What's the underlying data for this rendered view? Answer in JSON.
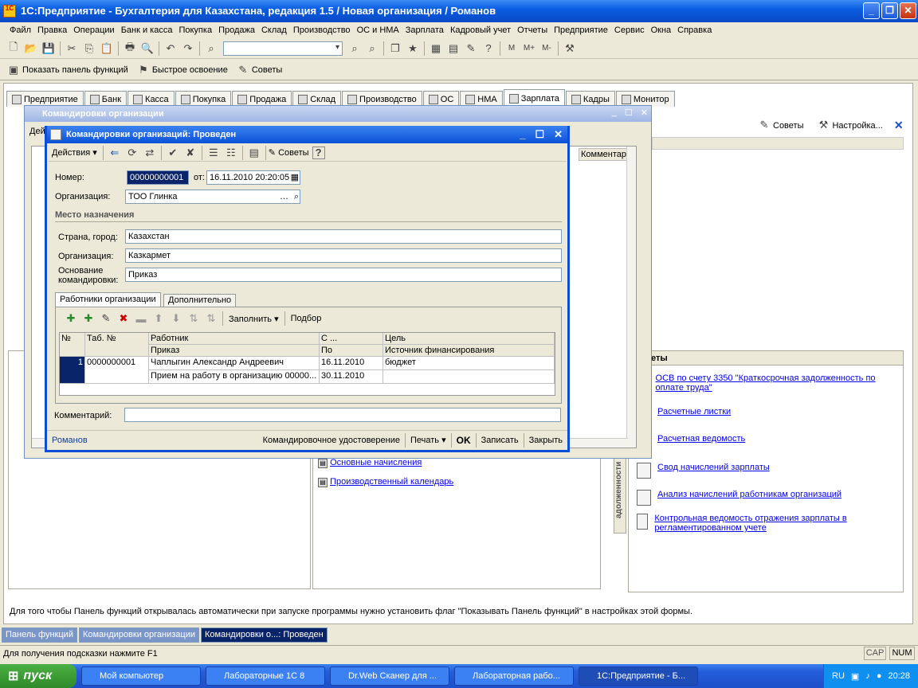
{
  "app": {
    "title": "1С:Предприятие - Бухгалтерия для Казахстана, редакция 1.5 / Новая организация / Романов",
    "icon_text": "1C\nV8"
  },
  "menu": [
    "Файл",
    "Правка",
    "Операции",
    "Банк и касса",
    "Покупка",
    "Продажа",
    "Склад",
    "Производство",
    "ОС и НМА",
    "Зарплата",
    "Кадровый учет",
    "Отчеты",
    "Предприятие",
    "Сервис",
    "Окна",
    "Справка"
  ],
  "toolbar3": {
    "show_panel": "Показать панель функций",
    "quick": "Быстрое освоение",
    "tips": "Советы"
  },
  "tabs": [
    "Предприятие",
    "Банк",
    "Касса",
    "Покупка",
    "Продажа",
    "Склад",
    "Производство",
    "ОС",
    "НМА",
    "Зарплата",
    "Кадры",
    "Монитор"
  ],
  "right_toolbar": {
    "tips": "Советы",
    "settings": "Настройка..."
  },
  "bg_window": {
    "title": "Командировки организации",
    "partial_label": "Дей",
    "col_comment": "Комментар"
  },
  "dialog": {
    "title": "Командировки организаций: Проведен",
    "toolbar": {
      "actions": "Действия",
      "tips": "Советы"
    },
    "number_label": "Номер:",
    "number": "00000000001",
    "from_label": "от:",
    "date": "16.11.2010 20:20:05",
    "org_label": "Организация:",
    "org": "ТОО Глинка",
    "section": "Место назначения",
    "country_label": "Страна, город:",
    "country": "Казахстан",
    "dest_org_label": "Организация:",
    "dest_org": "Казкармет",
    "basis_label1": "Основание",
    "basis_label2": "командировки:",
    "basis": "Приказ",
    "tab1": "Работники организации",
    "tab2": "Дополнительно",
    "fill": "Заполнить",
    "pick": "Подбор",
    "headers": {
      "num": "№",
      "tab": "Таб. №",
      "worker": "Работник",
      "order": "Приказ",
      "from": "С ...",
      "to": "По",
      "goal": "Цель",
      "source": "Источник финансирования"
    },
    "row": {
      "num": "1",
      "tab": "0000000001",
      "worker": "Чаплыгин Александр Андреевич",
      "order": "Прием на работу в организацию 00000...",
      "from": "16.11.2010",
      "to": "30.11.2010",
      "goal": "бюджет",
      "source": ""
    },
    "comment_label": "Комментарий:",
    "footer": {
      "user": "Романов",
      "cert": "Командировочное удостоверение",
      "print": "Печать",
      "ok": "OK",
      "save": "Записать",
      "close": "Закрыть"
    }
  },
  "right_panel": {
    "header": "еты",
    "links": [
      "ОСВ по счету 3350 \"Краткосрочная задолженность по оплате труда\"",
      "Расчетные листки",
      "Расчетная ведомость",
      "Свод начислений зарплаты",
      "Анализ начислений работникам организаций",
      "Контрольная ведомость отражения зарплаты в регламентированном учете"
    ],
    "vertical": "адолженности"
  },
  "mid_links": [
    "Основные начисления",
    "Производственный календарь"
  ],
  "hint": "Для того чтобы Панель функций открывалась автоматически при запуске программы нужно установить флаг \"Показывать Панель функций\" в настройках этой формы.",
  "window_tabs": [
    "Панель функций",
    "Командировки организации",
    "Командировки о...: Проведен"
  ],
  "status": {
    "text": "Для получения подсказки нажмите F1",
    "cap": "CAP",
    "num": "NUM"
  },
  "taskbar": {
    "start": "пуск",
    "items": [
      "Мой компьютер",
      "Лабораторные 1С 8",
      "Dr.Web Сканер для ...",
      "Лабораторная рабо...",
      "1С:Предприятие - Б..."
    ],
    "lang": "RU",
    "time": "20:28"
  }
}
